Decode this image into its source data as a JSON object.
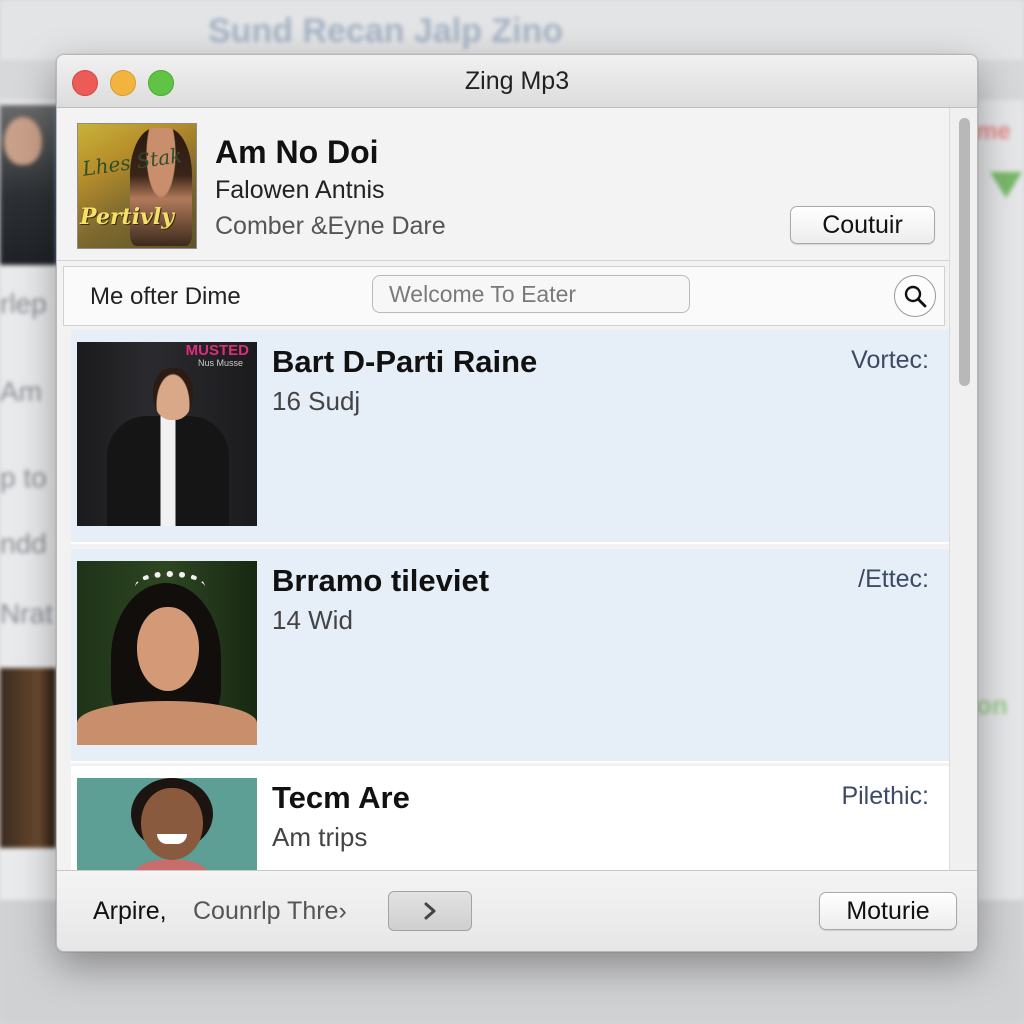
{
  "background": {
    "title": "Sund Recan Jalp Zino",
    "side_texts": [
      "rlep",
      "Am",
      "p to",
      "ndd",
      "Nrat"
    ],
    "right_text_top": "me",
    "right_text_bottom": "on"
  },
  "window": {
    "title": "Zing Mp3"
  },
  "now_playing": {
    "title": "Am No Doi",
    "artist": "Falowen Antnis",
    "album": "Comber &Eyne Dare",
    "button_label": "Coutuir",
    "art_text_top": "Lhes Stak",
    "art_text_bottom": "Pertivly"
  },
  "filter_bar": {
    "label": "Me ofter Dime",
    "search_placeholder": "Welcome To Eater"
  },
  "list": {
    "items": [
      {
        "title": "Bart D-Parti Raine",
        "subtitle": "16 Sudj",
        "tag": "Vortec:",
        "thumb_text": "MUSTED",
        "thumb_subtext": "Nus Musse"
      },
      {
        "title": "Brramo tileviet",
        "subtitle": "14 Wid",
        "tag": "/Ettec:"
      },
      {
        "title": "Tecm Are",
        "subtitle": "Am trips",
        "tag": "Pilethic:"
      }
    ]
  },
  "footer": {
    "label_left": "Arpire,",
    "label_mid": "Counrlp Thre›",
    "button_label": "Moturie"
  },
  "colors": {
    "selected_row": "#e6eef8",
    "close": "#ec5b56",
    "minimize": "#f3b43f",
    "zoom": "#5fc444"
  },
  "icons": [
    "close-icon",
    "minimize-icon",
    "zoom-icon",
    "search-icon",
    "chevron-right-icon"
  ]
}
